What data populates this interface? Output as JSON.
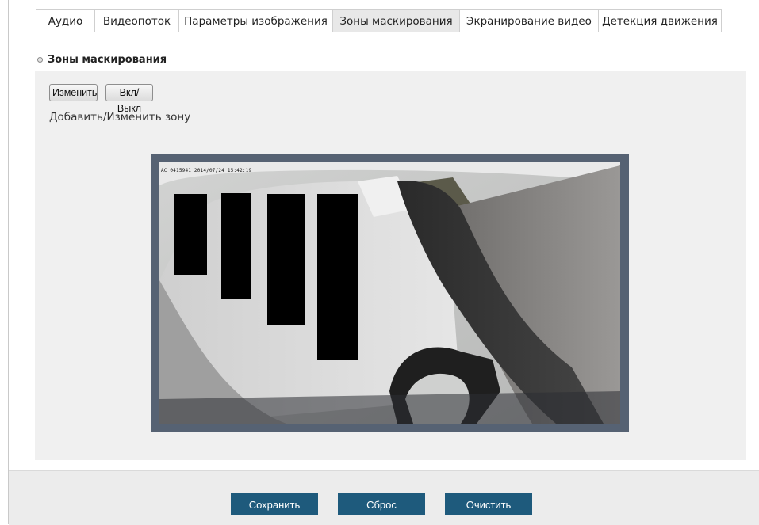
{
  "tabs": [
    {
      "label": "Аудио",
      "active": false
    },
    {
      "label": "Видеопоток",
      "active": false
    },
    {
      "label": "Параметры изображения",
      "active": false
    },
    {
      "label": "Зоны маскирования",
      "active": true
    },
    {
      "label": "Экранирование видео",
      "active": false
    },
    {
      "label": "Детекция движения",
      "active": false
    }
  ],
  "section": {
    "title": "Зоны маскирования"
  },
  "controls": {
    "edit_label": "Изменить",
    "toggle_label": "Вкл/Выкл",
    "zone_label": "Добавить/Изменить зону"
  },
  "video": {
    "osd_text": "AC 0415941 2014/07/24 15:42:19",
    "mask_zone_count": 4
  },
  "actions": {
    "save_label": "Сохранить",
    "reset_label": "Сброс",
    "clear_label": "Очистить"
  },
  "colors": {
    "accent": "#1e5a7c",
    "video_border": "#566273",
    "active_tab": "#e8e8e8"
  }
}
